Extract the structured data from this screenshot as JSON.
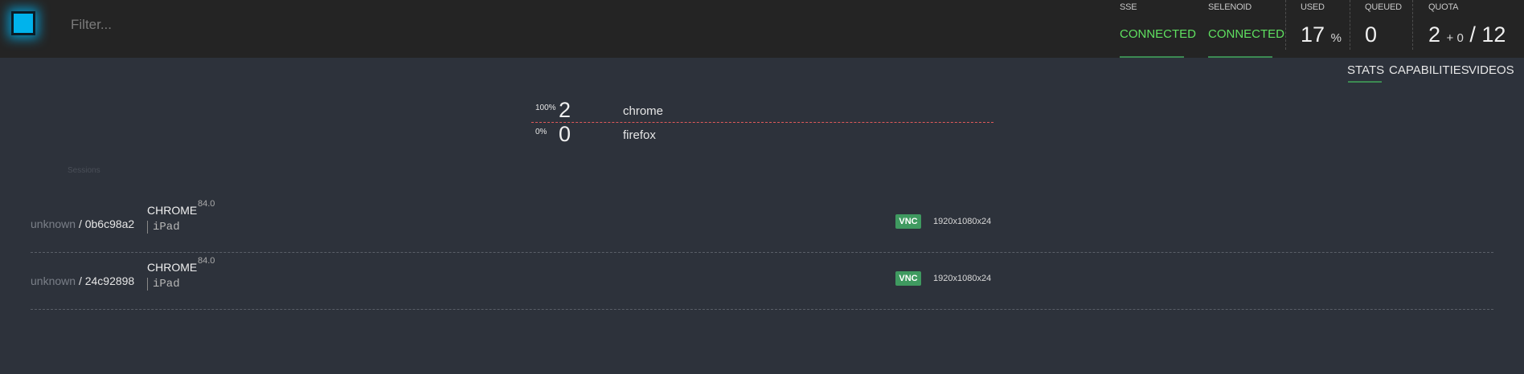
{
  "header": {
    "filter_placeholder": "Filter...",
    "sse": {
      "label": "SSE",
      "status": "CONNECTED"
    },
    "selenoid": {
      "label": "SELENOID",
      "status": "CONNECTED"
    },
    "used": {
      "label": "USED",
      "value": "17",
      "unit": "%"
    },
    "queued": {
      "label": "QUEUED",
      "value": "0"
    },
    "quota": {
      "label": "QUOTA",
      "value": "2",
      "plus": "+ 0",
      "total": "/ 12"
    }
  },
  "tabs": [
    "STATS",
    "CAPABILITIES",
    "VIDEOS"
  ],
  "active_tab": "STATS",
  "browsers": [
    {
      "percent": "100%",
      "count": "2",
      "name": "chrome"
    },
    {
      "percent": "0%",
      "count": "0",
      "name": "firefox"
    }
  ],
  "sessions_title": "Sessions",
  "sessions": [
    {
      "user": "unknown",
      "sep": "/",
      "id": "0b6c98a2",
      "browser": "CHROME",
      "version": "84.0",
      "platform": "iPad",
      "vnc": "VNC",
      "resolution": "1920x1080x24"
    },
    {
      "user": "unknown",
      "sep": "/",
      "id": "24c92898",
      "browser": "CHROME",
      "version": "84.0",
      "platform": "iPad",
      "vnc": "VNC",
      "resolution": "1920x1080x24"
    }
  ],
  "colors": {
    "accent_green": "#5fe060",
    "logo_blue": "#00b3ec",
    "divider_red": "#e05a5a",
    "vnc_badge": "#3f9a60"
  }
}
